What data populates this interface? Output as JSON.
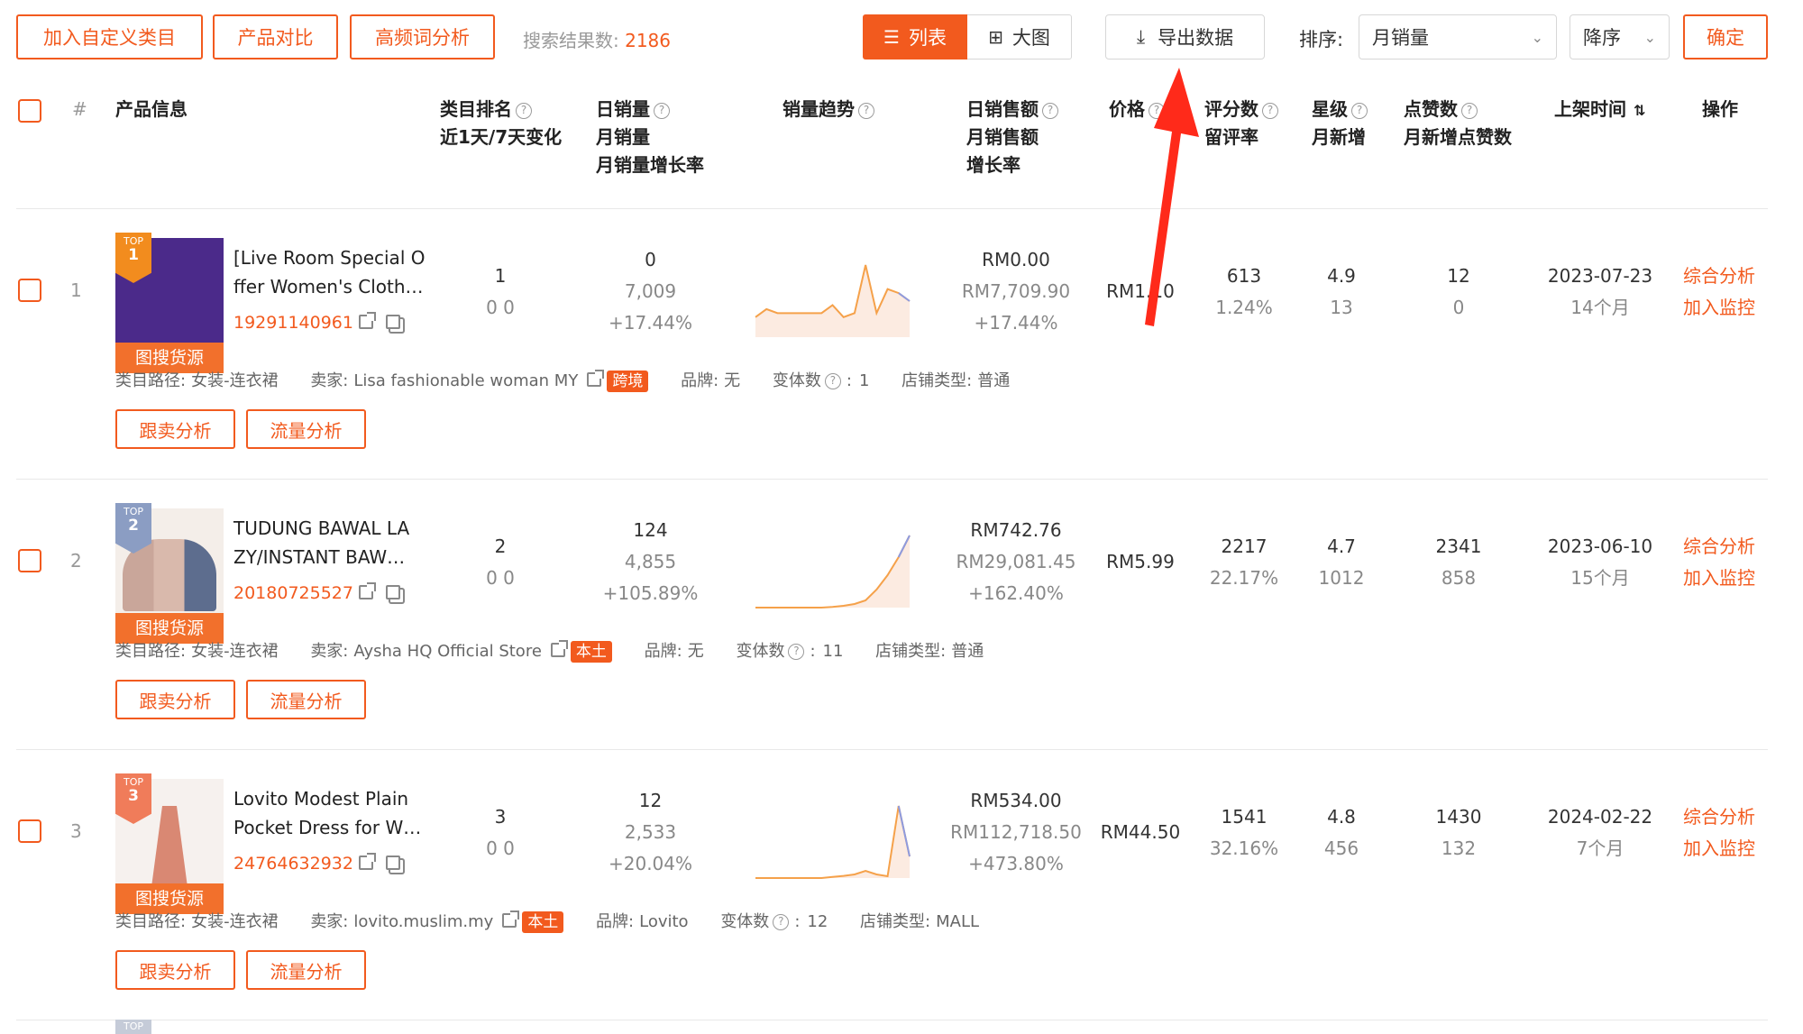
{
  "toolbar": {
    "add_category": "加入自定义类目",
    "compare": "产品对比",
    "keyword_analysis": "高频词分析",
    "result_label": "搜索结果数:",
    "result_count": "2186",
    "view_list": "列表",
    "view_grid": "大图",
    "export": "导出数据",
    "sort_label": "排序:",
    "sort_value": "月销量",
    "order_value": "降序",
    "confirm": "确定"
  },
  "table": {
    "headers": {
      "index": "#",
      "product": "产品信息",
      "rank_1": "类目排名",
      "rank_2": "近1天/7天变化",
      "sales_1": "日销量",
      "sales_2": "月销量",
      "sales_3": "月销量增长率",
      "trend": "销量趋势",
      "revenue_1": "日销售额",
      "revenue_2": "月销售额",
      "revenue_3": "增长率",
      "price": "价格",
      "rating_1": "评分数",
      "rating_2": "留评率",
      "stars_1": "星级",
      "stars_2": "月新增",
      "likes_1": "点赞数",
      "likes_2": "月新增点赞数",
      "date": "上架时间",
      "ops": "操作"
    },
    "labels": {
      "image_search": "图搜货源",
      "category": "类目路径:",
      "seller": "卖家:",
      "brand": "品牌:",
      "variants": "变体数",
      "shop_type": "店铺类型:",
      "follow_analysis": "跟卖分析",
      "traffic_analysis": "流量分析",
      "overall_analysis": "综合分析",
      "add_monitor": "加入监控",
      "top": "TOP"
    },
    "rows": [
      {
        "index": "1",
        "rank": "1",
        "name_line1": "[Live Room Special O",
        "name_line2": "ffer Women's Cloth…",
        "id": "19291140961",
        "rank_val": "1",
        "rank_change": "0 0",
        "daily_sales": "0",
        "monthly_sales": "7,009",
        "sales_growth": "+17.44%",
        "trend": [
          5,
          7,
          6,
          6,
          6,
          6,
          6,
          8,
          5,
          6,
          18,
          6,
          12,
          11,
          9
        ],
        "daily_revenue": "RM0.00",
        "monthly_revenue": "RM7,709.90",
        "revenue_growth": "+17.44%",
        "price": "RM1.10",
        "ratings": "613",
        "review_rate": "1.24%",
        "stars": "4.9",
        "stars_new": "13",
        "likes": "12",
        "likes_new": "0",
        "date": "2023-07-23",
        "age": "14个月",
        "category_path": "女装-连衣裙",
        "seller": "Lisa fashionable woman MY",
        "tag": "跨境",
        "brand": "无",
        "variants": "1",
        "shop_type": "普通"
      },
      {
        "index": "2",
        "rank": "2",
        "name_line1": "TUDUNG BAWAL LA",
        "name_line2": "ZY/INSTANT BAW…",
        "id": "20180725527",
        "rank_val": "2",
        "rank_change": "0 0",
        "daily_sales": "124",
        "monthly_sales": "4,855",
        "sales_growth": "+105.89%",
        "trend": [
          0,
          0,
          0,
          0,
          0,
          0,
          0,
          0.2,
          0.5,
          1,
          2,
          5,
          9,
          14,
          20
        ],
        "daily_revenue": "RM742.76",
        "monthly_revenue": "RM29,081.45",
        "revenue_growth": "+162.40%",
        "price": "RM5.99",
        "ratings": "2217",
        "review_rate": "22.17%",
        "stars": "4.7",
        "stars_new": "1012",
        "likes": "2341",
        "likes_new": "858",
        "date": "2023-06-10",
        "age": "15个月",
        "category_path": "女装-连衣裙",
        "seller": "Aysha HQ Official Store",
        "tag": "本土",
        "brand": "无",
        "variants": "11",
        "shop_type": "普通"
      },
      {
        "index": "3",
        "rank": "3",
        "name_line1": "Lovito Modest Plain",
        "name_line2": "Pocket Dress for W…",
        "id": "24764632932",
        "rank_val": "3",
        "rank_change": "0 0",
        "daily_sales": "12",
        "monthly_sales": "2,533",
        "sales_growth": "+20.04%",
        "trend": [
          0,
          0,
          0,
          0,
          0,
          0,
          0,
          0.3,
          0.6,
          1,
          2,
          1,
          0.5,
          20,
          6
        ],
        "daily_revenue": "RM534.00",
        "monthly_revenue": "RM112,718.50",
        "revenue_growth": "+473.80%",
        "price": "RM44.50",
        "ratings": "1541",
        "review_rate": "32.16%",
        "stars": "4.8",
        "stars_new": "456",
        "likes": "1430",
        "likes_new": "132",
        "date": "2024-02-22",
        "age": "7个月",
        "category_path": "女装-连衣裙",
        "seller": "lovito.muslim.my",
        "tag": "本土",
        "brand": "Lovito",
        "variants": "12",
        "shop_type": "MALL"
      }
    ]
  },
  "colors": {
    "accent": "#f25a1e",
    "rank1_badge": "#f28c1e",
    "rank2_badge": "#8b9dc3",
    "rank3_badge": "#f07c5a",
    "annotation_arrow": "#ff2a1a"
  }
}
